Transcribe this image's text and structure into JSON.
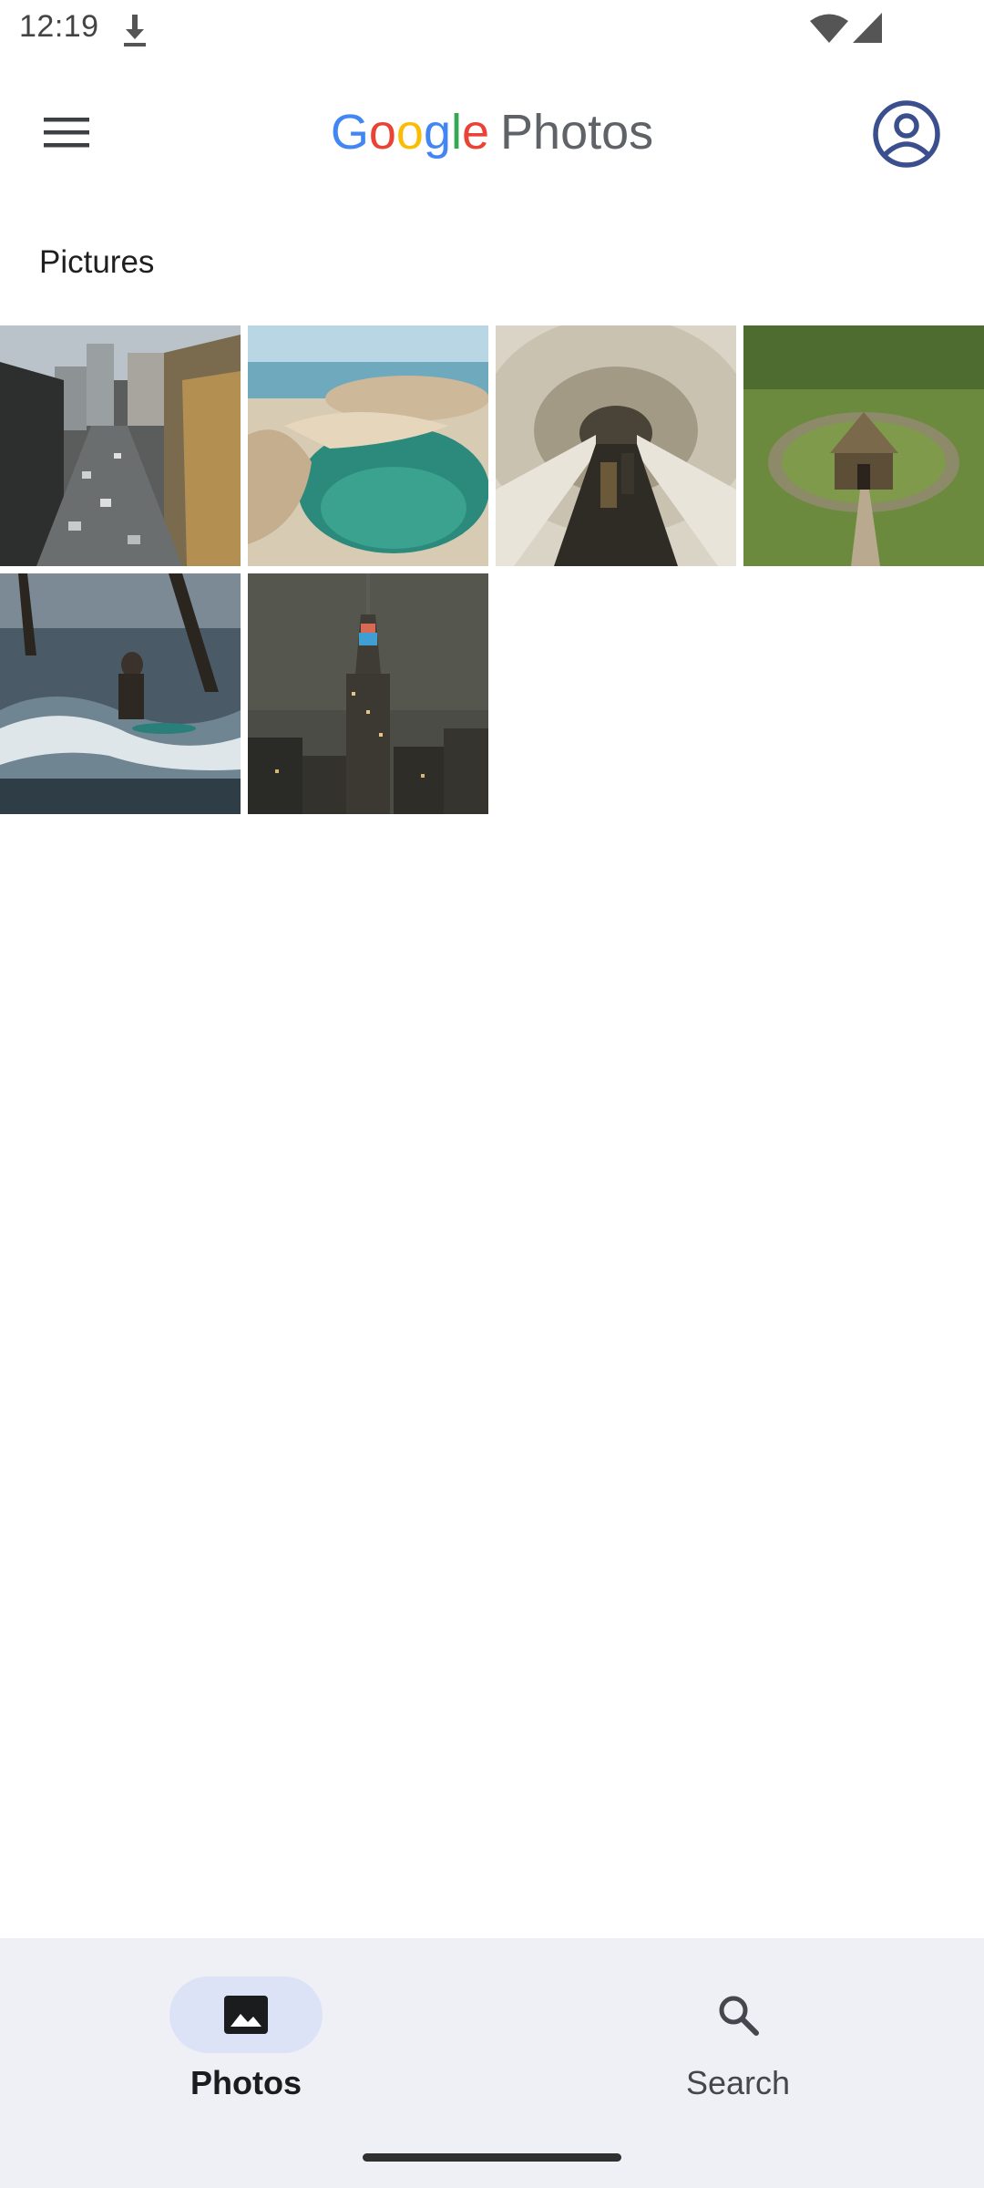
{
  "status_bar": {
    "time": "12:19",
    "download_icon": "download-icon",
    "wifi_icon": "wifi-icon",
    "signal_icon": "cellular-signal-icon"
  },
  "app_bar": {
    "title_letters": [
      "G",
      "o",
      "o",
      "g",
      "l",
      "e"
    ],
    "title_suffix": "Photos",
    "menu_icon": "hamburger-menu-icon",
    "account_icon": "account-circle-icon",
    "brand_colors": [
      "#4285F4",
      "#EA4335",
      "#FBBC05",
      "#4285F4",
      "#34A853",
      "#EA4335"
    ]
  },
  "section": {
    "title": "Pictures"
  },
  "photos": [
    {
      "subject": "city street with buildings"
    },
    {
      "subject": "beach cove with turquoise water"
    },
    {
      "subject": "escalator tunnel"
    },
    {
      "subject": "turf house in green field"
    },
    {
      "subject": "surfer on wave"
    },
    {
      "subject": "night skyline with skyscraper"
    }
  ],
  "bottom_nav": {
    "items": [
      {
        "label": "Photos",
        "icon": "photo-icon",
        "selected": true
      },
      {
        "label": "Search",
        "icon": "search-icon",
        "selected": false
      }
    ],
    "background": "#eff0f5",
    "selected_pill_color": "#dde3f7"
  }
}
